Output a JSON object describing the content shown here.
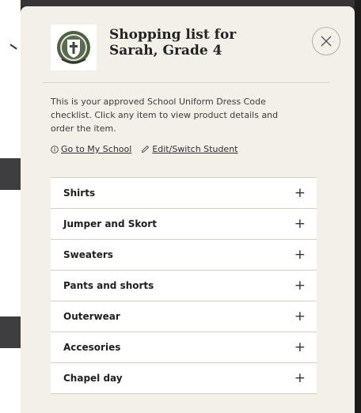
{
  "modal": {
    "title_line1": "Shopping list for",
    "title_line2": "Sarah, Grade 4",
    "intro": "This is your approved School Uniform Dress Code checklist. Click any item to view product details and order the item.",
    "links": {
      "my_school": "Go to My School",
      "edit_student": "Edit/Switch Student"
    },
    "categories": [
      {
        "label": "Shirts"
      },
      {
        "label": "Jumper and Skort"
      },
      {
        "label": "Sweaters"
      },
      {
        "label": "Pants and shorts"
      },
      {
        "label": "Outerwear"
      },
      {
        "label": "Accesories"
      },
      {
        "label": "Chapel day"
      }
    ],
    "expand_symbol": "+"
  },
  "colors": {
    "modal_bg": "#f3f0ea",
    "row_bg": "#ffffff",
    "text": "#1f1f1f",
    "border": "#d4d0c8",
    "logo_green": "#4f5f43"
  },
  "icons": {
    "close": "close-icon",
    "info": "info-icon",
    "edit": "pencil-icon",
    "expand": "plus-icon",
    "logo": "school-crest-logo"
  }
}
